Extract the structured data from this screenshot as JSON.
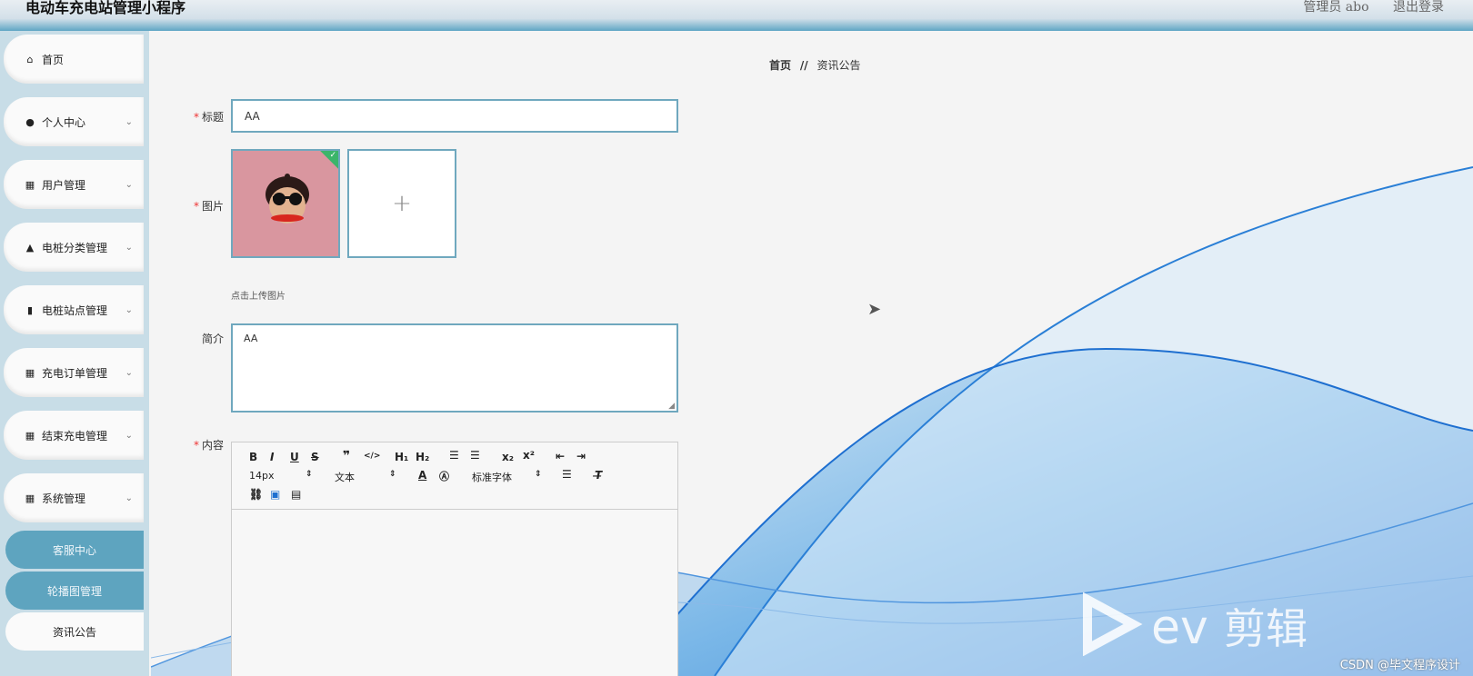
{
  "header": {
    "title": "电动车充电站管理小程序",
    "user": "管理员 abo",
    "logout": "退出登录"
  },
  "sidebar": {
    "items": [
      {
        "label": "首页",
        "icon": "home-icon"
      },
      {
        "label": "个人中心",
        "icon": "user-icon"
      },
      {
        "label": "用户管理",
        "icon": "grid-icon"
      },
      {
        "label": "电桩分类管理",
        "icon": "thumb-icon"
      },
      {
        "label": "电桩站点管理",
        "icon": "book-icon"
      },
      {
        "label": "充电订单管理",
        "icon": "grid-icon"
      },
      {
        "label": "结束充电管理",
        "icon": "grid-icon"
      },
      {
        "label": "系统管理",
        "icon": "grid-icon"
      }
    ],
    "subitems": [
      {
        "label": "客服中心"
      },
      {
        "label": "轮播图管理"
      },
      {
        "label": "资讯公告"
      }
    ]
  },
  "breadcrumb": {
    "home": "首页",
    "separator": "//",
    "current": "资讯公告"
  },
  "form": {
    "title_label": "标题",
    "title_value": "AA",
    "image_label": "图片",
    "upload_hint": "点击上传图片",
    "intro_label": "简介",
    "intro_value": "AA",
    "content_label": "内容",
    "font_size": "14px",
    "paragraph": "文本",
    "font_family": "标准字体"
  },
  "watermark": "CSDN @毕文程序设计",
  "colors": {
    "accent": "#5ea4bf",
    "border": "#6fa8be",
    "wave": "#1e6fd0"
  }
}
